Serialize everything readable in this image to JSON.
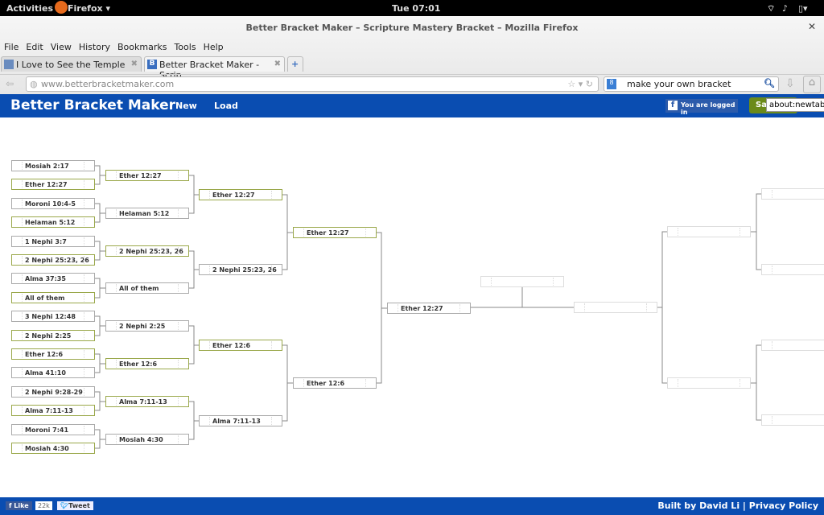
{
  "system": {
    "activities": "Activities",
    "app": "Firefox ▾",
    "clock": "Tue 07:01"
  },
  "window": {
    "title": "Better Bracket Maker – Scripture Mastery Bracket – Mozilla Firefox"
  },
  "menu": [
    "File",
    "Edit",
    "View",
    "History",
    "Bookmarks",
    "Tools",
    "Help"
  ],
  "tabs": [
    {
      "label": "I Love to See the Temple"
    },
    {
      "label": "Better Bracket Maker - Scrip..."
    }
  ],
  "url": "www.betterbracketmaker.com",
  "search": "make your own bracket",
  "app": {
    "brand": "Better Bracket Maker",
    "new": "New",
    "load": "Load",
    "fb_status": "You are logged in",
    "save": "Save",
    "tooltip": "about:newtab"
  },
  "footer": {
    "like": "Like",
    "like_count": "22k",
    "tweet": "Tweet",
    "built_by": "Built by David Li | Privacy Policy"
  },
  "bracket": {
    "round1": [
      "Mosiah 2:17",
      "Ether 12:27",
      "Moroni 10:4-5",
      "Helaman 5:12",
      "1 Nephi 3:7",
      "2 Nephi 25:23, 26",
      "Alma 37:35",
      "All of them",
      "3 Nephi 12:48",
      "2 Nephi 2:25",
      "Ether 12:6",
      "Alma 41:10",
      "2 Nephi 9:28-29",
      "Alma 7:11-13",
      "Moroni 7:41",
      "Mosiah 4:30"
    ],
    "round1_winners": [
      1,
      3,
      5,
      7,
      9,
      10,
      13,
      15
    ],
    "round2": [
      "Ether 12:27",
      "Helaman 5:12",
      "2 Nephi 25:23, 26",
      "All of them",
      "2 Nephi 2:25",
      "Ether 12:6",
      "Alma 7:11-13",
      "Mosiah 4:30"
    ],
    "round2_winners": [
      0,
      2,
      5,
      6
    ],
    "round3": [
      "Ether 12:27",
      "2 Nephi 25:23, 26",
      "Ether 12:6",
      "Alma 7:11-13"
    ],
    "round3_winners": [
      0,
      2
    ],
    "round4": [
      "Ether 12:27",
      "Ether 12:6"
    ],
    "round4_winners": [
      0
    ],
    "round5": [
      "Ether 12:27"
    ],
    "champion": ""
  }
}
